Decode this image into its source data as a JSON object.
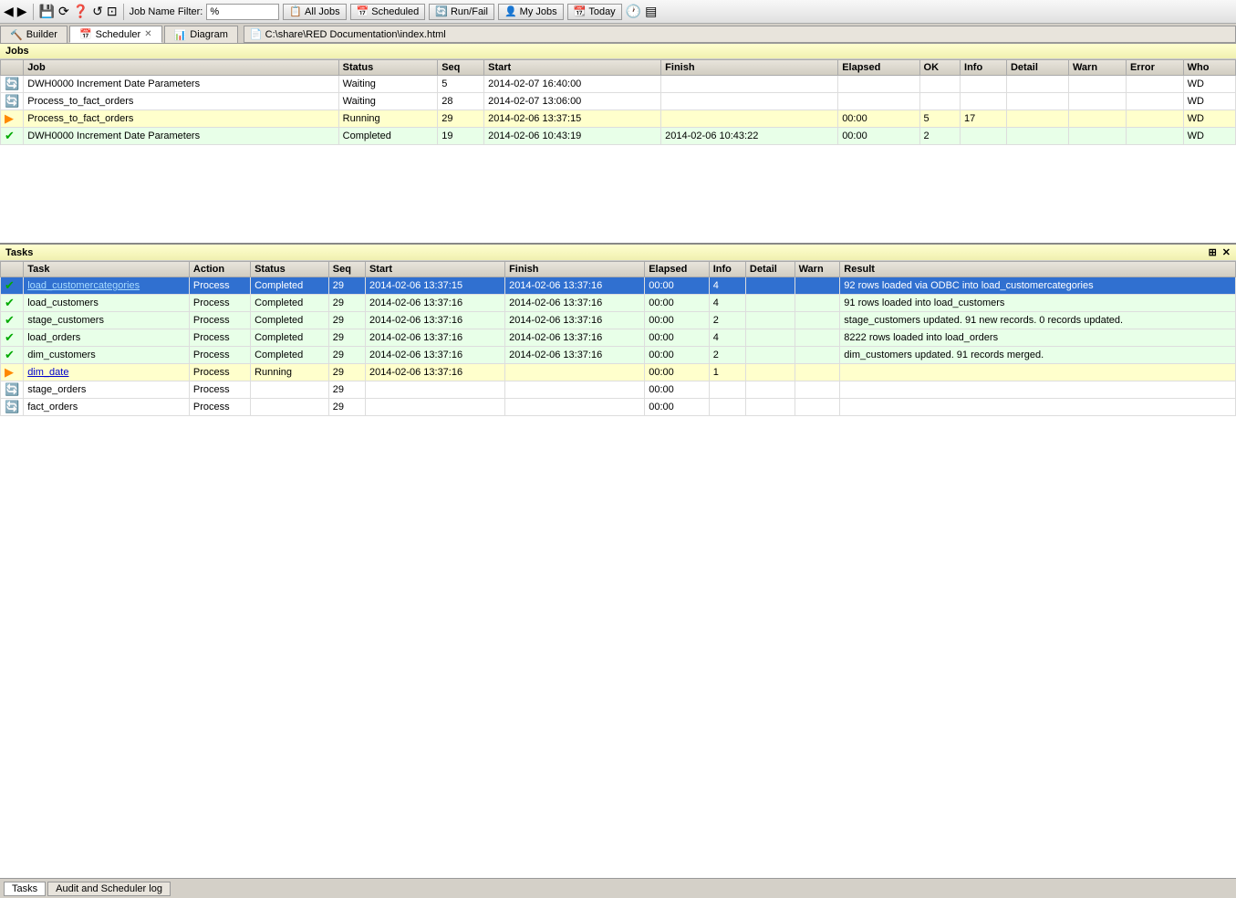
{
  "toolbar": {
    "filter_label": "Job Name Filter:",
    "filter_value": "%",
    "buttons": [
      "All Jobs",
      "Scheduled",
      "Run/Fail",
      "My Jobs",
      "Today"
    ],
    "icons": [
      "◀",
      "▶",
      "⟳",
      "⊕",
      "❓",
      "↺",
      "⊡",
      "▤"
    ]
  },
  "tabs": [
    {
      "label": "Builder",
      "icon": "🔨",
      "active": false,
      "closable": false
    },
    {
      "label": "Scheduler",
      "icon": "📅",
      "active": true,
      "closable": true
    },
    {
      "label": "Diagram",
      "icon": "📊",
      "active": false,
      "closable": false
    }
  ],
  "path": "C:\\share\\RED Documentation\\index.html",
  "jobs_panel": {
    "title": "Jobs",
    "columns": [
      "",
      "Job",
      "Status",
      "Seq",
      "Start",
      "Finish",
      "Elapsed",
      "OK",
      "Info",
      "Detail",
      "Warn",
      "Error",
      "Who"
    ],
    "rows": [
      {
        "icon": "spin",
        "job": "DWH0000 Increment Date Parameters",
        "status": "Waiting",
        "seq": "5",
        "start": "2014-02-07 16:40:00",
        "finish": "",
        "elapsed": "",
        "ok": "",
        "info": "",
        "detail": "",
        "warn": "",
        "error": "",
        "who": "WD",
        "rowtype": "normal"
      },
      {
        "icon": "spin",
        "job": "Process_to_fact_orders",
        "status": "Waiting",
        "seq": "28",
        "start": "2014-02-07 13:06:00",
        "finish": "",
        "elapsed": "",
        "ok": "",
        "info": "",
        "detail": "",
        "warn": "",
        "error": "",
        "who": "WD",
        "rowtype": "normal"
      },
      {
        "icon": "run",
        "job": "Process_to_fact_orders",
        "status": "Running",
        "seq": "29",
        "start": "2014-02-06 13:37:15",
        "finish": "",
        "elapsed": "00:00",
        "ok": "5",
        "info": "17",
        "detail": "",
        "warn": "",
        "error": "",
        "who": "WD",
        "rowtype": "running"
      },
      {
        "icon": "check",
        "job": "DWH0000 Increment Date Parameters",
        "status": "Completed",
        "seq": "19",
        "start": "2014-02-06 10:43:19",
        "finish": "2014-02-06 10:43:22",
        "elapsed": "00:00",
        "ok": "2",
        "info": "",
        "detail": "",
        "warn": "",
        "error": "",
        "who": "WD",
        "rowtype": "completed"
      }
    ]
  },
  "tasks_panel": {
    "title": "Tasks",
    "columns": [
      "",
      "Task",
      "Action",
      "Status",
      "Seq",
      "Start",
      "Finish",
      "Elapsed",
      "Info",
      "Detail",
      "Warn",
      "Result"
    ],
    "rows": [
      {
        "icon": "check",
        "task": "load_customercategories",
        "action": "Process",
        "status": "Completed",
        "seq": "29",
        "start": "2014-02-06 13:37:15",
        "finish": "2014-02-06 13:37:16",
        "elapsed": "00:00",
        "info": "4",
        "detail": "",
        "warn": "",
        "result": "92 rows loaded via ODBC into load_customercategories",
        "rowtype": "selected"
      },
      {
        "icon": "check",
        "task": "load_customers",
        "action": "Process",
        "status": "Completed",
        "seq": "29",
        "start": "2014-02-06 13:37:16",
        "finish": "2014-02-06 13:37:16",
        "elapsed": "00:00",
        "info": "4",
        "detail": "",
        "warn": "",
        "result": "91 rows loaded into load_customers",
        "rowtype": "completed"
      },
      {
        "icon": "check",
        "task": "stage_customers",
        "action": "Process",
        "status": "Completed",
        "seq": "29",
        "start": "2014-02-06 13:37:16",
        "finish": "2014-02-06 13:37:16",
        "elapsed": "00:00",
        "info": "2",
        "detail": "",
        "warn": "",
        "result": "stage_customers updated. 91 new records. 0 records updated.",
        "rowtype": "completed"
      },
      {
        "icon": "check",
        "task": "load_orders",
        "action": "Process",
        "status": "Completed",
        "seq": "29",
        "start": "2014-02-06 13:37:16",
        "finish": "2014-02-06 13:37:16",
        "elapsed": "00:00",
        "info": "4",
        "detail": "",
        "warn": "",
        "result": "8222 rows loaded into load_orders",
        "rowtype": "completed"
      },
      {
        "icon": "check",
        "task": "dim_customers",
        "action": "Process",
        "status": "Completed",
        "seq": "29",
        "start": "2014-02-06 13:37:16",
        "finish": "2014-02-06 13:37:16",
        "elapsed": "00:00",
        "info": "2",
        "detail": "",
        "warn": "",
        "result": "dim_customers updated. 91 records merged.",
        "rowtype": "completed"
      },
      {
        "icon": "run",
        "task": "dim_date",
        "action": "Process",
        "status": "Running",
        "seq": "29",
        "start": "2014-02-06 13:37:16",
        "finish": "",
        "elapsed": "00:00",
        "info": "1",
        "detail": "",
        "warn": "",
        "result": "",
        "rowtype": "running"
      },
      {
        "icon": "spin",
        "task": "stage_orders",
        "action": "Process",
        "status": "",
        "seq": "29",
        "start": "",
        "finish": "",
        "elapsed": "00:00",
        "info": "",
        "detail": "",
        "warn": "",
        "result": "",
        "rowtype": "normal"
      },
      {
        "icon": "spin",
        "task": "fact_orders",
        "action": "Process",
        "status": "",
        "seq": "29",
        "start": "",
        "finish": "",
        "elapsed": "00:00",
        "info": "",
        "detail": "",
        "warn": "",
        "result": "",
        "rowtype": "normal"
      }
    ]
  },
  "bottom_tabs": [
    "Tasks",
    "Audit and Scheduler log"
  ]
}
